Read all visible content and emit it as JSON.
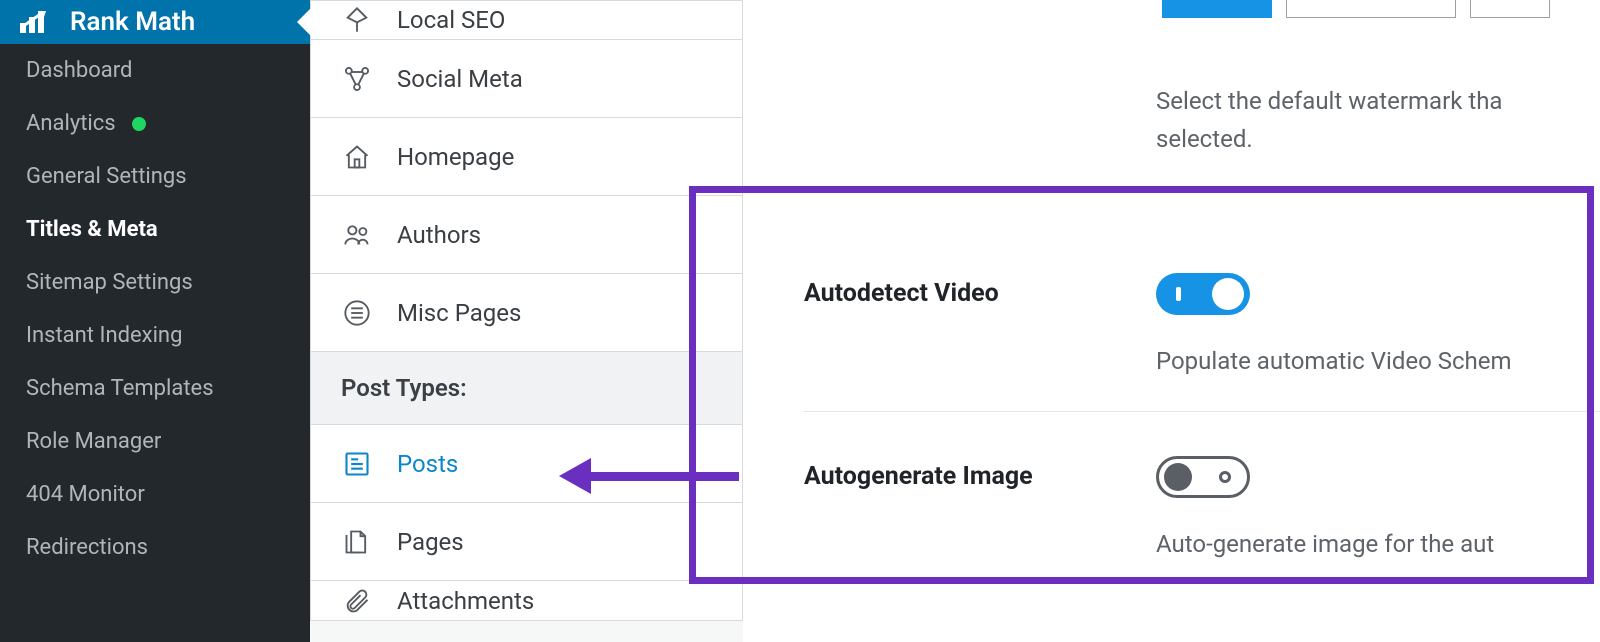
{
  "sidebar": {
    "brand": "Rank Math",
    "items": [
      {
        "label": "Dashboard"
      },
      {
        "label": "Analytics",
        "dot": true
      },
      {
        "label": "General Settings"
      },
      {
        "label": "Titles & Meta",
        "active": true
      },
      {
        "label": "Sitemap Settings"
      },
      {
        "label": "Instant Indexing"
      },
      {
        "label": "Schema Templates"
      },
      {
        "label": "Role Manager"
      },
      {
        "label": "404 Monitor"
      },
      {
        "label": "Redirections"
      }
    ]
  },
  "settings": {
    "items_top": [
      {
        "label": "Local SEO"
      },
      {
        "label": "Social Meta"
      },
      {
        "label": "Homepage"
      },
      {
        "label": "Authors"
      },
      {
        "label": "Misc Pages"
      }
    ],
    "section_label": "Post Types:",
    "items_bottom": [
      {
        "label": "Posts",
        "active": true
      },
      {
        "label": "Pages"
      },
      {
        "label": "Attachments"
      }
    ]
  },
  "main": {
    "watermark_desc": "Select the default watermark tha selected.",
    "rows": [
      {
        "label": "Autodetect Video",
        "toggle": "on",
        "hint": "Populate automatic Video Schem"
      },
      {
        "label": "Autogenerate Image",
        "toggle": "off",
        "hint": "Auto-generate image for the aut"
      }
    ]
  }
}
